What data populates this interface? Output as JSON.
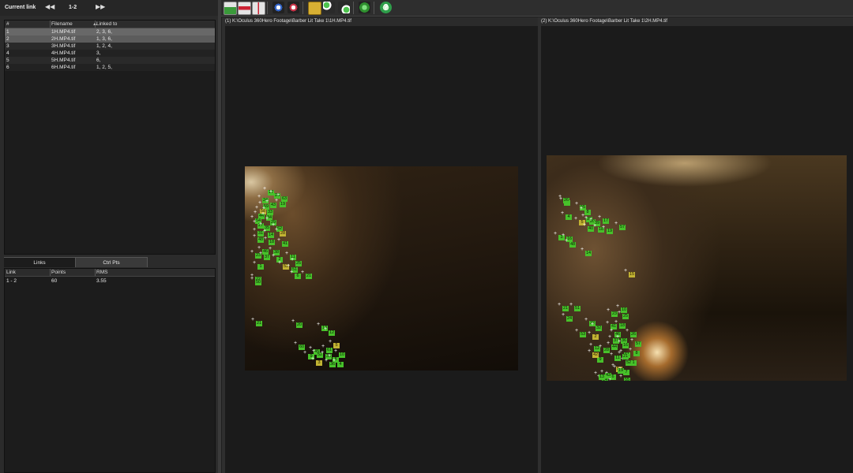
{
  "current_link": {
    "label": "Current link",
    "value": "1-2",
    "prev_icon": "arrow-left-icon",
    "next_icon": "arrow-right-icon"
  },
  "file_table": {
    "headers": [
      "#",
      "Filename",
      "Linked to"
    ],
    "rows": [
      {
        "num": "1",
        "filename": "1H.MP4.tif",
        "linked": "2, 3, 6,"
      },
      {
        "num": "2",
        "filename": "2H.MP4.tif",
        "linked": "1, 3, 6,"
      },
      {
        "num": "3",
        "filename": "3H.MP4.tif",
        "linked": "1, 2, 4,"
      },
      {
        "num": "4",
        "filename": "4H.MP4.tif",
        "linked": "3,"
      },
      {
        "num": "5",
        "filename": "5H.MP4.tif",
        "linked": "6,"
      },
      {
        "num": "6",
        "filename": "6H.MP4.tif",
        "linked": "1, 2, 5,"
      }
    ]
  },
  "tabs": [
    "Links",
    "Ctrl Pts"
  ],
  "link_table": {
    "headers": [
      "Link",
      "Points",
      "RMS"
    ],
    "rows": [
      {
        "link": "1 - 2",
        "points": "60",
        "rms": "3.55"
      }
    ]
  },
  "views": [
    {
      "path": "(1) K:\\Oculus 360Hero Footage\\Barber Lit Take 1\\1H.MP4.tif"
    },
    {
      "path": "(2) K:\\Oculus 360Hero Footage\\Barber Lit Take 1\\2H.MP4.tif"
    }
  ],
  "colors": {
    "point_green": "#47c12a",
    "point_yellow": "#c2b333"
  },
  "points_view1": [
    "17",
    "26",
    "63",
    "24",
    "59",
    "43",
    "19",
    "58",
    "33",
    "44",
    "34",
    "54",
    "29",
    "27",
    "35",
    "62",
    "31",
    "14",
    "28",
    "48",
    "18",
    "41",
    "46",
    "38",
    "23",
    "37",
    "2",
    "11",
    "25",
    "53",
    "51",
    "1",
    "6",
    "21",
    "22",
    "50",
    "21",
    "20",
    "13",
    "12",
    "5",
    "61",
    "10",
    "60",
    "45",
    "9",
    "52",
    "30",
    "8",
    "36",
    "4",
    "3"
  ],
  "points_view2": [
    "13",
    "26",
    "55",
    "4",
    "8",
    "38",
    "20",
    "5",
    "39",
    "17",
    "40",
    "18",
    "19",
    "57",
    "3",
    "16",
    "48",
    "14",
    "15",
    "21",
    "51",
    "10",
    "23",
    "24",
    "25",
    "22",
    "32",
    "41",
    "53",
    "2",
    "18",
    "46",
    "37",
    "36",
    "12",
    "44",
    "16",
    "9",
    "11",
    "61",
    "59",
    "7",
    "1",
    "6",
    "47",
    "34",
    "13",
    "55",
    "52",
    "19",
    "43",
    "42",
    "28",
    "8",
    "57",
    "26",
    "21"
  ]
}
